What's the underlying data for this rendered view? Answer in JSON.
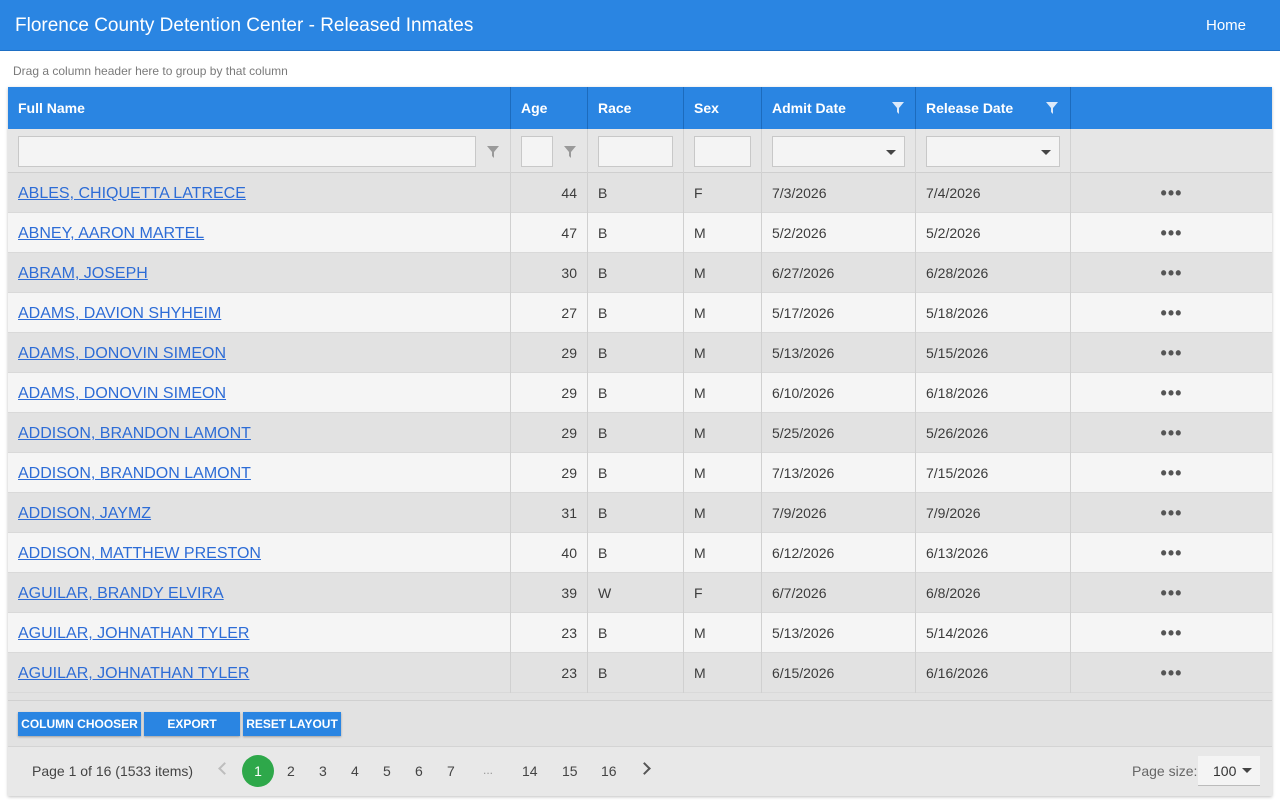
{
  "app": {
    "title": "Florence County Detention Center - Released Inmates",
    "home_label": "Home"
  },
  "grid": {
    "group_hint": "Drag a column header here to group by that column",
    "columns": [
      "Full Name",
      "Age",
      "Race",
      "Sex",
      "Admit Date",
      "Release Date"
    ],
    "rows": [
      {
        "name": "ABLES, CHIQUETTA LATRECE",
        "age": "44",
        "race": "B",
        "sex": "F",
        "admit": "7/3/2026",
        "release": "7/4/2026"
      },
      {
        "name": "ABNEY, AARON MARTEL",
        "age": "47",
        "race": "B",
        "sex": "M",
        "admit": "5/2/2026",
        "release": "5/2/2026"
      },
      {
        "name": "ABRAM, JOSEPH",
        "age": "30",
        "race": "B",
        "sex": "M",
        "admit": "6/27/2026",
        "release": "6/28/2026"
      },
      {
        "name": "ADAMS, DAVION SHYHEIM",
        "age": "27",
        "race": "B",
        "sex": "M",
        "admit": "5/17/2026",
        "release": "5/18/2026"
      },
      {
        "name": "ADAMS, DONOVIN SIMEON",
        "age": "29",
        "race": "B",
        "sex": "M",
        "admit": "5/13/2026",
        "release": "5/15/2026"
      },
      {
        "name": "ADAMS, DONOVIN SIMEON",
        "age": "29",
        "race": "B",
        "sex": "M",
        "admit": "6/10/2026",
        "release": "6/18/2026"
      },
      {
        "name": "ADDISON, BRANDON LAMONT",
        "age": "29",
        "race": "B",
        "sex": "M",
        "admit": "5/25/2026",
        "release": "5/26/2026"
      },
      {
        "name": "ADDISON, BRANDON LAMONT",
        "age": "29",
        "race": "B",
        "sex": "M",
        "admit": "7/13/2026",
        "release": "7/15/2026"
      },
      {
        "name": "ADDISON, JAYMZ",
        "age": "31",
        "race": "B",
        "sex": "M",
        "admit": "7/9/2026",
        "release": "7/9/2026"
      },
      {
        "name": "ADDISON, MATTHEW PRESTON",
        "age": "40",
        "race": "B",
        "sex": "M",
        "admit": "6/12/2026",
        "release": "6/13/2026"
      },
      {
        "name": "AGUILAR, BRANDY ELVIRA",
        "age": "39",
        "race": "W",
        "sex": "F",
        "admit": "6/7/2026",
        "release": "6/8/2026"
      },
      {
        "name": "AGUILAR, JOHNATHAN TYLER",
        "age": "23",
        "race": "B",
        "sex": "M",
        "admit": "5/13/2026",
        "release": "5/14/2026"
      },
      {
        "name": "AGUILAR, JOHNATHAN TYLER",
        "age": "23",
        "race": "B",
        "sex": "M",
        "admit": "6/15/2026",
        "release": "6/16/2026"
      }
    ],
    "row_action_icon": "more-horizontal-icon",
    "row_action_glyph": "•••"
  },
  "toolbar": {
    "column_chooser": "COLUMN CHOOSER",
    "export": "EXPORT",
    "reset_layout": "RESET LAYOUT"
  },
  "pager": {
    "info": "Page 1 of 16 (1533 items)",
    "pages": [
      "1",
      "2",
      "3",
      "4",
      "5",
      "6",
      "7",
      "...",
      "14",
      "15",
      "16"
    ],
    "current_page": "1",
    "page_size_label": "Page size:",
    "page_size": "100"
  },
  "colors": {
    "header_blue": "#2a85e2",
    "link_blue": "#2d6cd6",
    "active_page_green": "#2ea84a"
  }
}
